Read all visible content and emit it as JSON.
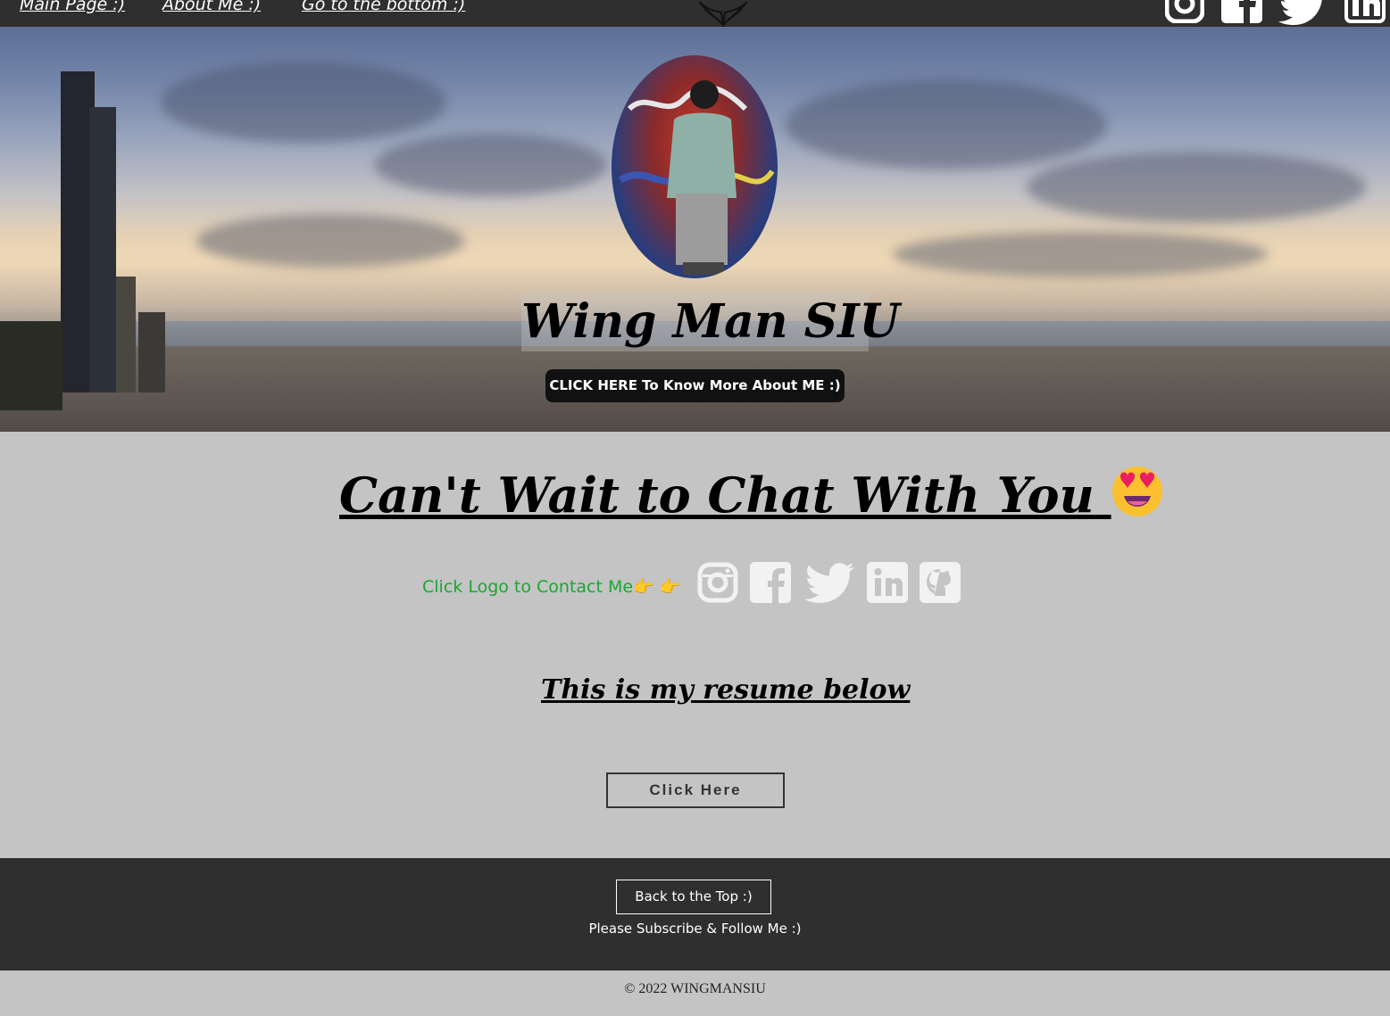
{
  "nav": {
    "links": [
      "Main Page :)",
      "About Me :)",
      "Go to the bottom :)"
    ],
    "logo_icon": "wings-logo-icon",
    "social_icons": [
      "instagram-icon",
      "facebook-icon",
      "twitter-icon",
      "linkedin-icon"
    ]
  },
  "hero": {
    "name": "Wing Man SIU",
    "button_label": "CLICK HERE To Know More About ME :)"
  },
  "chat": {
    "title": "Can't Wait to Chat With You",
    "emoji": "smiling-face-with-heart-eyes-emoji",
    "contact_text": "Click Logo to Contact Me",
    "pointer_emoji": "👉 👉",
    "social_icons": [
      "instagram-icon",
      "facebook-icon",
      "twitter-icon",
      "linkedin-icon",
      "github-icon"
    ]
  },
  "resume": {
    "title": "This is my resume below",
    "button_label": "Click Here"
  },
  "footer": {
    "back_to_top": "Back to the Top :)",
    "subscribe": "Please Subscribe & Follow Me :)",
    "copyright": "© 2022 WINGMANSIU"
  },
  "colors": {
    "nav_bg": "#2f2f2f",
    "page_bg": "#c4c4c4",
    "contact_text": "#1aa632",
    "social_mid": "#f2f2f2"
  }
}
